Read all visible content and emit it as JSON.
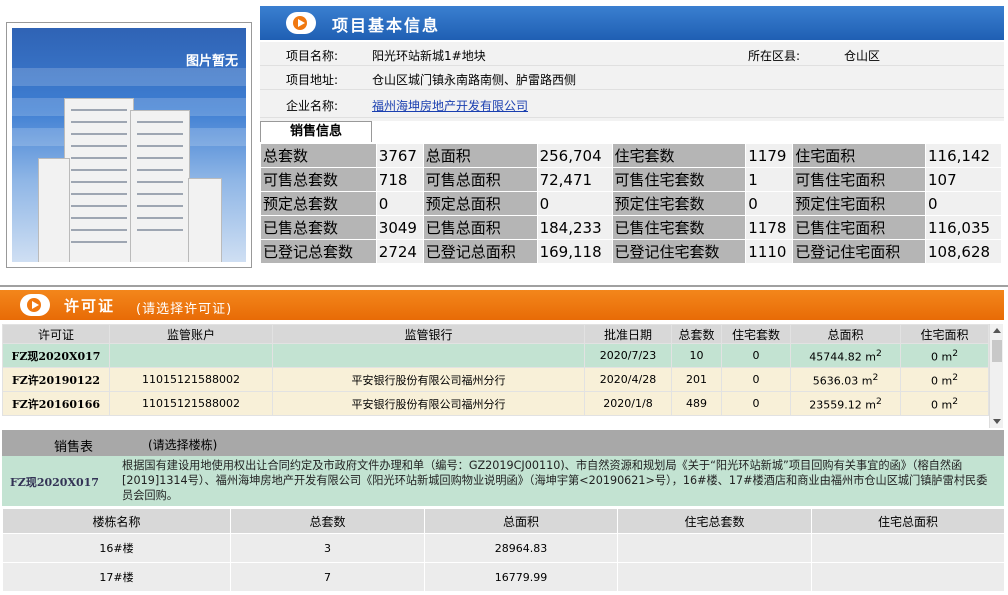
{
  "photo": {
    "placeholder": "图片暂无"
  },
  "basic": {
    "title": "项目基本信息",
    "name_label": "项目名称:",
    "name": "阳光环站新城1#地块",
    "district_label": "所在区县:",
    "district": "仓山区",
    "address_label": "项目地址:",
    "address": "仓山区城门镇永南路南侧、胪雷路西侧",
    "company_label": "企业名称:",
    "company": "福州海坤房地产开发有限公司"
  },
  "sales": {
    "tab": "销售信息",
    "rows": [
      [
        "总套数",
        "3767",
        "总面积",
        "256,704",
        "住宅套数",
        "1179",
        "住宅面积",
        "116,142"
      ],
      [
        "可售总套数",
        "718",
        "可售总面积",
        "72,471",
        "可售住宅套数",
        "1",
        "可售住宅面积",
        "107"
      ],
      [
        "预定总套数",
        "0",
        "预定总面积",
        "0",
        "预定住宅套数",
        "0",
        "预定住宅面积",
        "0"
      ],
      [
        "已售总套数",
        "3049",
        "已售总面积",
        "184,233",
        "已售住宅套数",
        "1178",
        "已售住宅面积",
        "116,035"
      ],
      [
        "已登记总套数",
        "2724",
        "已登记总面积",
        "169,118",
        "已登记住宅套数",
        "1110",
        "已登记住宅面积",
        "108,628"
      ]
    ]
  },
  "permit": {
    "title": "许可证",
    "subtitle": "(请选择许可证)",
    "headers": [
      "许可证",
      "监管账户",
      "监管银行",
      "批准日期",
      "总套数",
      "住宅套数",
      "总面积",
      "住宅面积"
    ],
    "rows": [
      {
        "code": "FZ现2020X017",
        "account": "",
        "bank": "",
        "date": "2020/7/23",
        "total": "10",
        "res": "0",
        "area": "45744.82 m",
        "res_area": "0 m"
      },
      {
        "code": "FZ许20190122",
        "account": "11015121588002",
        "bank": "平安银行股份有限公司福州分行",
        "date": "2020/4/28",
        "total": "201",
        "res": "0",
        "area": "5636.03 m",
        "res_area": "0 m"
      },
      {
        "code": "FZ许20160166",
        "account": "11015121588002",
        "bank": "平安银行股份有限公司福州分行",
        "date": "2020/1/8",
        "total": "489",
        "res": "0",
        "area": "23559.12 m",
        "res_area": "0 m"
      }
    ],
    "sup": "2"
  },
  "sales_table": {
    "title": "销售表",
    "prompt": "(请选择楼栋)",
    "selected_code": "FZ现2020X017",
    "description": "根据国有建设用地使用权出让合同约定及市政府文件办理和单（编号：GZ2019CJ00110)、市自然资源和规划局《关于“阳光环站新城”项目回购有关事宜的函》（榕自然函[2019]1314号）、福州海坤房地产开发有限公司《阳光环站新城回购物业说明函》（海坤宇第<20190621>号），16#楼、17#楼酒店和商业由福州市仓山区城门镇胪雷村民委员会回购。",
    "headers": [
      "楼栋名称",
      "总套数",
      "总面积",
      "住宅总套数",
      "住宅总面积"
    ],
    "rows": [
      {
        "name": "16#楼",
        "total": "3",
        "area": "28964.83",
        "res_total": "",
        "res_area": ""
      },
      {
        "name": "17#楼",
        "total": "7",
        "area": "16779.99",
        "res_total": "",
        "res_area": ""
      }
    ]
  }
}
